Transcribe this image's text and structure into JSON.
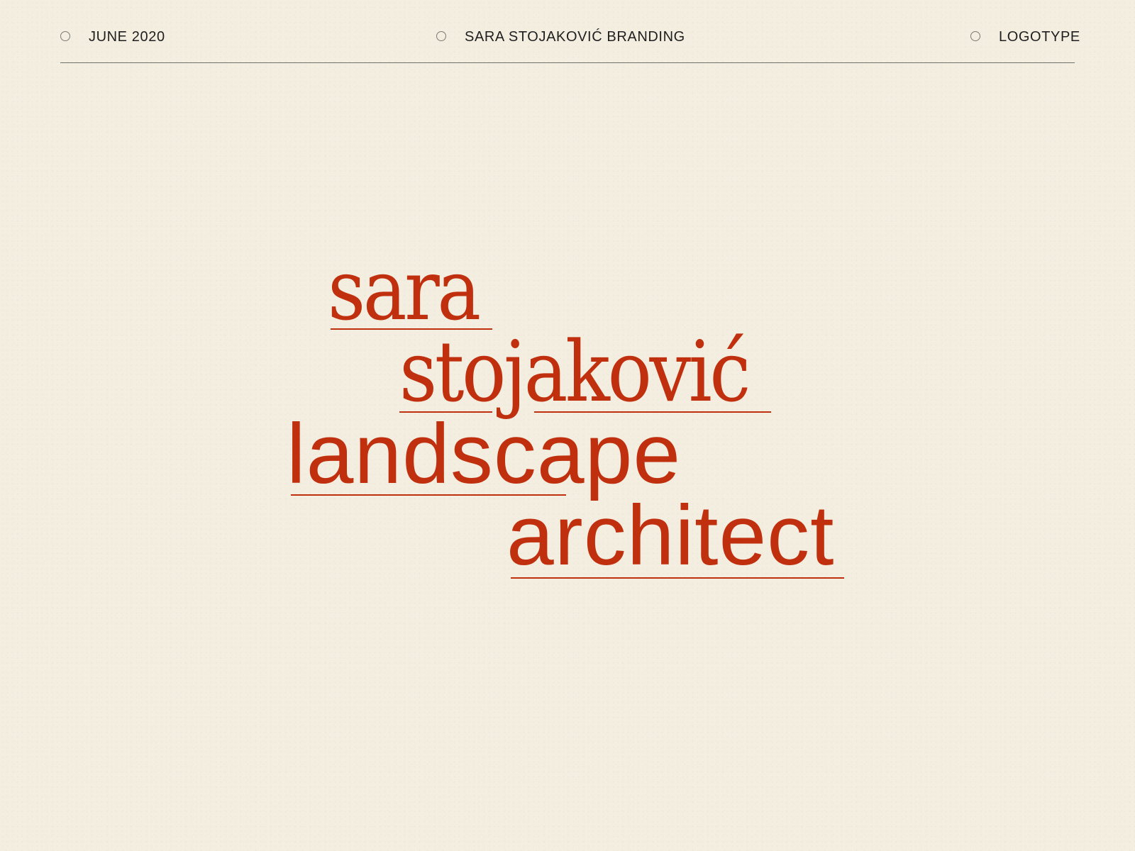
{
  "header": {
    "date": "JUNE 2020",
    "project": "SARA STOJAKOVIĆ BRANDING",
    "category": "LOGOTYPE"
  },
  "logotype": {
    "line1": "sara",
    "line2": "stojaković",
    "line3": "landscape",
    "line4": "architect"
  },
  "colors": {
    "background": "#f3eee0",
    "accent": "#c0300f",
    "text": "#1f1f1f",
    "rule": "#6f726d"
  },
  "icons": {
    "bullet": "circle-outline-icon"
  }
}
